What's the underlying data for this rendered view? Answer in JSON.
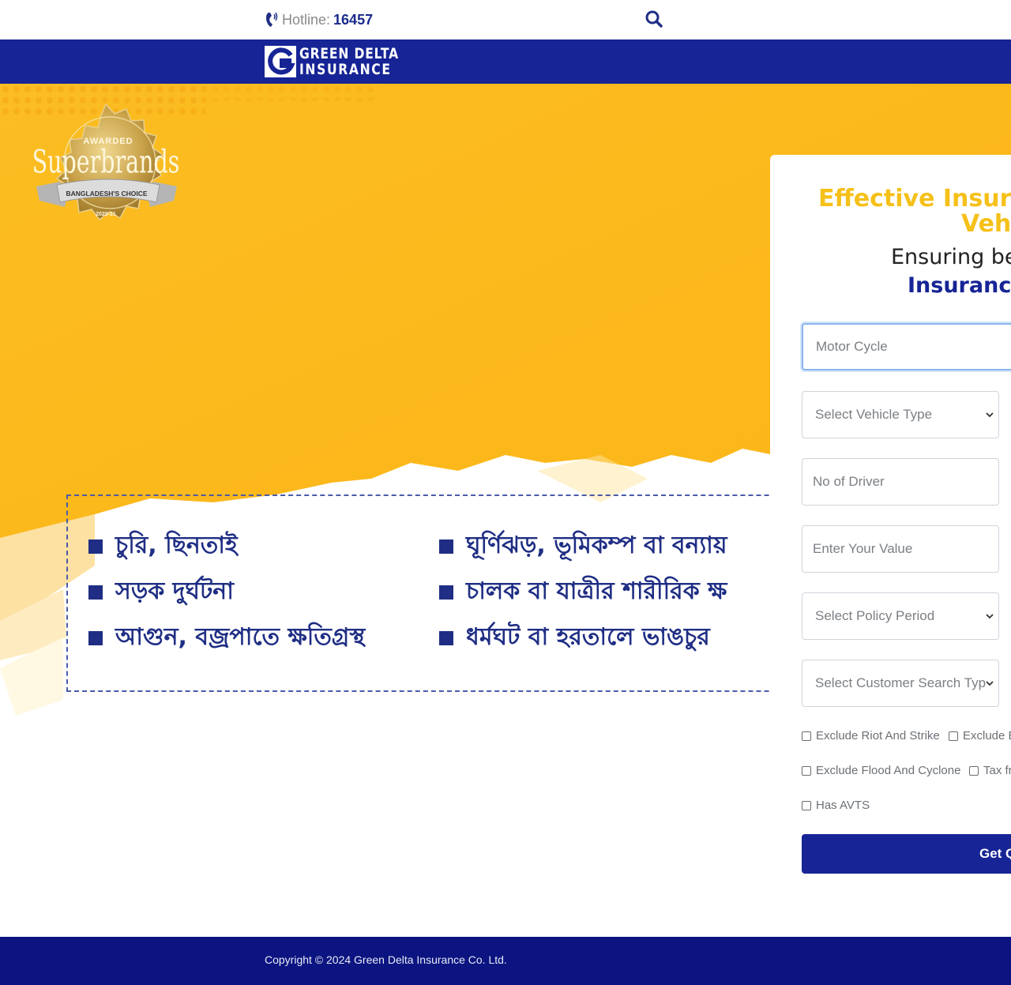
{
  "header": {
    "hotline_label": "Hotline:",
    "hotline_number": "16457",
    "search_icon": "search-icon",
    "phone_icon": "phone-icon"
  },
  "brand": {
    "line1": "GREEN DELTA",
    "line2": "INSURANCE",
    "color_primary": "#162495",
    "color_accent": "#f5c018"
  },
  "badge": {
    "top": "AWARDED",
    "name": "Superbrands",
    "ribbon": "BANGLADESH'S CHOICE",
    "year": "2020-21"
  },
  "perils": [
    "চুরি, ছিনতাই",
    "সড়ক দুর্ঘটনা",
    "আগুন, বজ্রপাতে ক্ষতিগ্রস্থ",
    "ঘূর্ণিঝড়, ভূমিকম্প বা বন্যায়",
    "চালক বা যাত্রীর শারীরিক ক্ষ",
    "ধর্মঘট বা হরতালে ভাঙচুর"
  ],
  "quote_panel": {
    "title_line1": "Effective Insuran",
    "title_line2": "Vehi",
    "subtitle": "Ensuring be",
    "subtitle_bold": "Insurance",
    "vehicle_category_value": "Motor Cycle",
    "vehicle_type_placeholder": "Select Vehicle Type",
    "no_of_driver_placeholder": "No of Driver",
    "value_placeholder": "Enter Your Value",
    "policy_period_placeholder": "Select Policy Period",
    "customer_search_placeholder": "Select Customer Search Typ",
    "checkboxes": {
      "riot": "Exclude Riot And Strike",
      "exclude_e": "Exclude E",
      "flood": "Exclude Flood And Cyclone",
      "tax": "Tax fr",
      "avts": "Has AVTS"
    },
    "submit_label": "Get Q"
  },
  "footer": {
    "copyright": "Copyright © 2024 Green Delta Insurance Co. Ltd."
  }
}
